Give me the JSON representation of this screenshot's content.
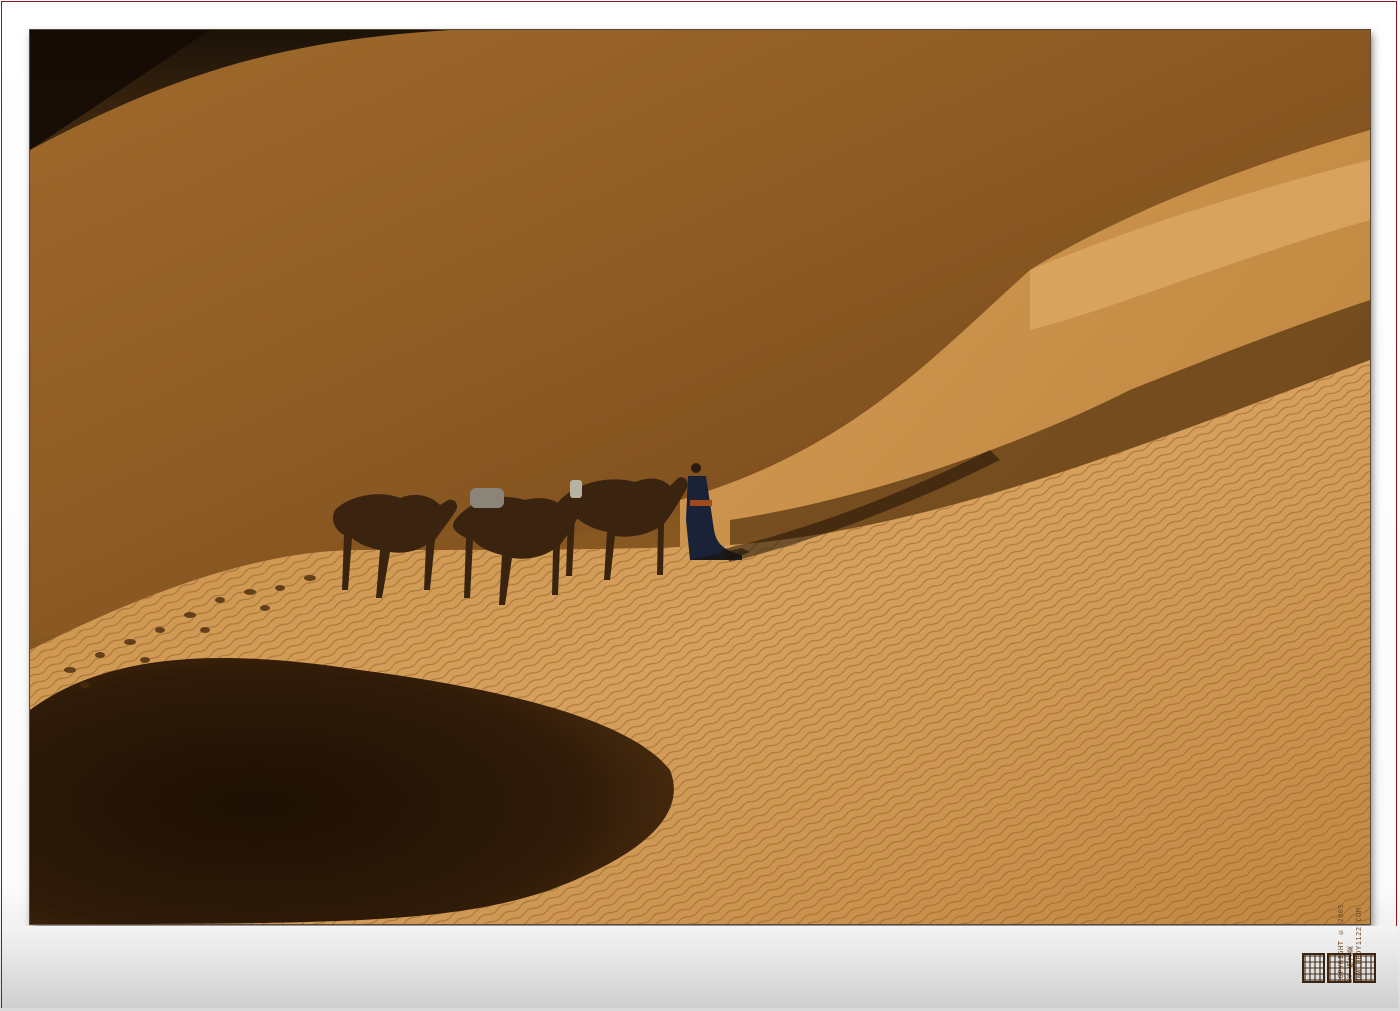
{
  "photo": {
    "subject": "",
    "colors": {
      "sand_light": "#d8a561",
      "sand_mid": "#b8823c",
      "sand_dark": "#5a3712",
      "shadow": "#241305",
      "sky_dark": "#1c1208",
      "frame_border": "#8a1a1a"
    }
  },
  "watermark": {
    "text": "COPYRIGHT © 2005 BY 杨之夏 WWW.HEDY1122.COM"
  }
}
